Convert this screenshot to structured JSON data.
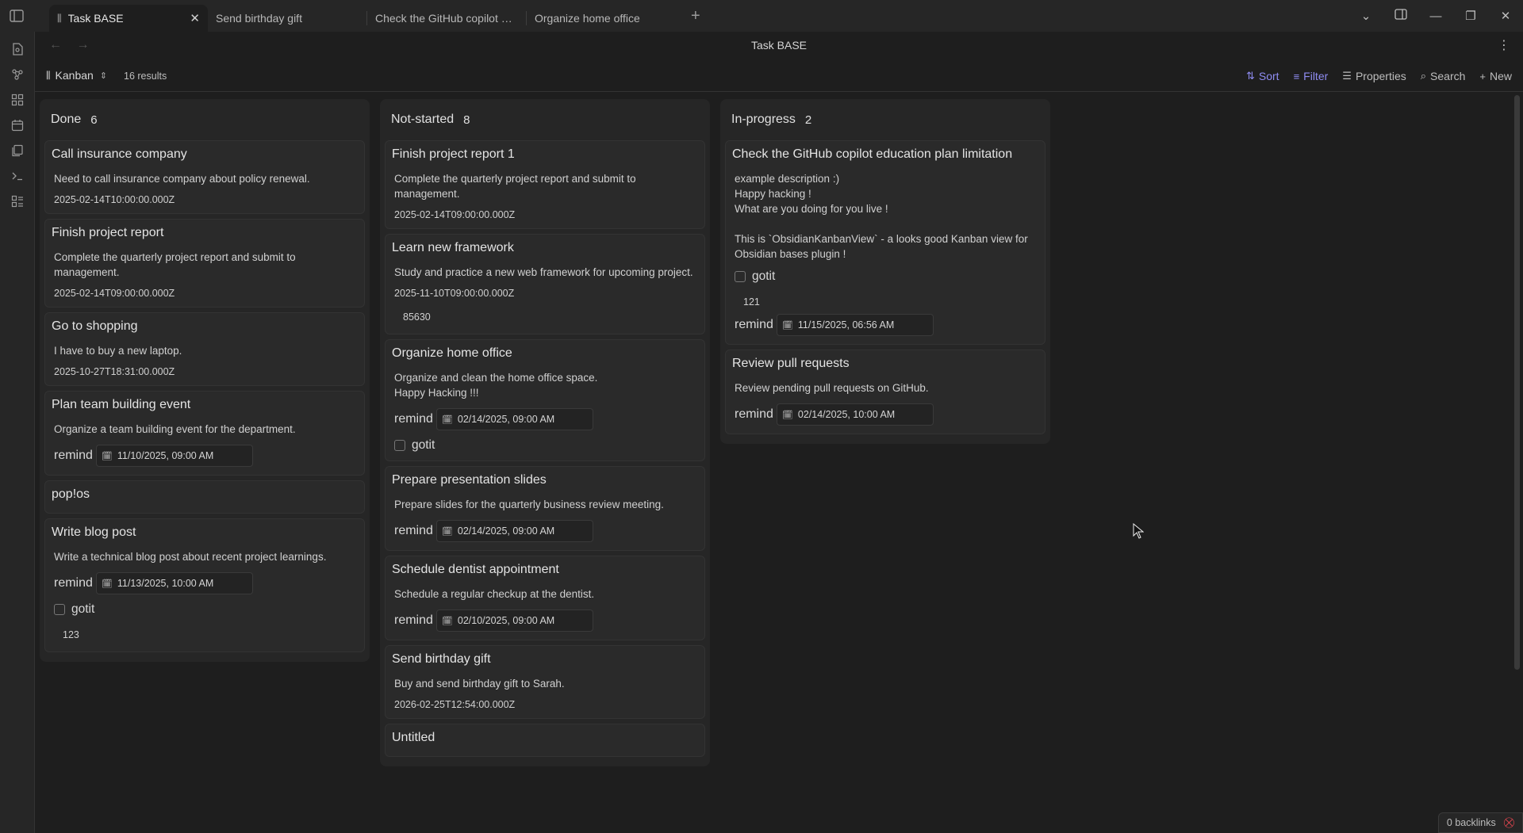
{
  "tabs": [
    {
      "label": "Task BASE",
      "active": true,
      "close": "✕"
    },
    {
      "label": "Send birthday gift"
    },
    {
      "label": "Check the GitHub copilot education plan limitation"
    },
    {
      "label": "Organize home office"
    }
  ],
  "page": {
    "title": "Task BASE"
  },
  "toolbar": {
    "view_label": "Kanban",
    "results": "16 results",
    "sort": "Sort",
    "filter": "Filter",
    "properties": "Properties",
    "search": "Search",
    "new": "New"
  },
  "columns": [
    {
      "name": "Done",
      "count": "6",
      "cards": [
        {
          "title": "Call insurance company",
          "desc": "Need to call insurance company about policy renewal.",
          "date": "2025-02-14T10:00:00.000Z"
        },
        {
          "title": "Finish project report",
          "desc": "Complete the quarterly project report and submit to management.",
          "date": "2025-02-14T09:00:00.000Z"
        },
        {
          "title": "Go to shopping",
          "desc": "I have to buy a new laptop.",
          "date": "2025-10-27T18:31:00.000Z"
        },
        {
          "title": "Plan team building event",
          "desc": "Organize a team building event for the department.",
          "remind_label": "remind",
          "remind": "11/10/2025, 09:00 AM"
        },
        {
          "title": "pop!os"
        },
        {
          "title": "Write blog post",
          "desc": "Write a technical blog post about recent project learnings.",
          "remind_label": "remind",
          "remind": "11/13/2025, 10:00 AM",
          "check_label": "gotit",
          "num": "123"
        }
      ]
    },
    {
      "name": "Not-started",
      "count": "8",
      "cards": [
        {
          "title": "Finish project report 1",
          "desc": "Complete the quarterly project report and submit to management.",
          "date": "2025-02-14T09:00:00.000Z"
        },
        {
          "title": "Learn new framework",
          "desc": "Study and practice a new web framework for upcoming project.",
          "date": "2025-11-10T09:00:00.000Z",
          "num": "85630"
        },
        {
          "title": "Organize home office",
          "desc": "Organize and clean the home office space.\nHappy Hacking !!!",
          "remind_label": "remind",
          "remind": "02/14/2025, 09:00 AM",
          "check_label": "gotit"
        },
        {
          "title": "Prepare presentation slides",
          "desc": "Prepare slides for the quarterly business review meeting.",
          "remind_label": "remind",
          "remind": "02/14/2025, 09:00 AM"
        },
        {
          "title": "Schedule dentist appointment",
          "desc": "Schedule a regular checkup at the dentist.",
          "remind_label": "remind",
          "remind": "02/10/2025, 09:00 AM"
        },
        {
          "title": "Send birthday gift",
          "desc": "Buy and send birthday gift to Sarah.",
          "date": "2026-02-25T12:54:00.000Z"
        },
        {
          "title": "Untitled"
        }
      ]
    },
    {
      "name": "In-progress",
      "count": "2",
      "cards": [
        {
          "title": "Check the GitHub copilot education plan limitation",
          "desc": "example description :)\nHappy hacking !\nWhat are you doing for you live !\n\nThis is `ObsidianKanbanView` - a looks good Kanban view for Obsidian bases plugin !",
          "check_label": "gotit",
          "num": "121",
          "remind_label": "remind",
          "remind": "11/15/2025, 06:56 AM"
        },
        {
          "title": "Review pull requests",
          "desc": "Review pending pull requests on GitHub.",
          "remind_label": "remind",
          "remind": "02/14/2025, 10:00 AM"
        }
      ]
    }
  ],
  "status": {
    "backlinks": "0 backlinks"
  },
  "colors": {
    "accent": "#8f8cf2",
    "background": "#1e1e1e",
    "panel": "#262626",
    "card": "#2a2a2a",
    "sync_error": "#e0454f"
  }
}
